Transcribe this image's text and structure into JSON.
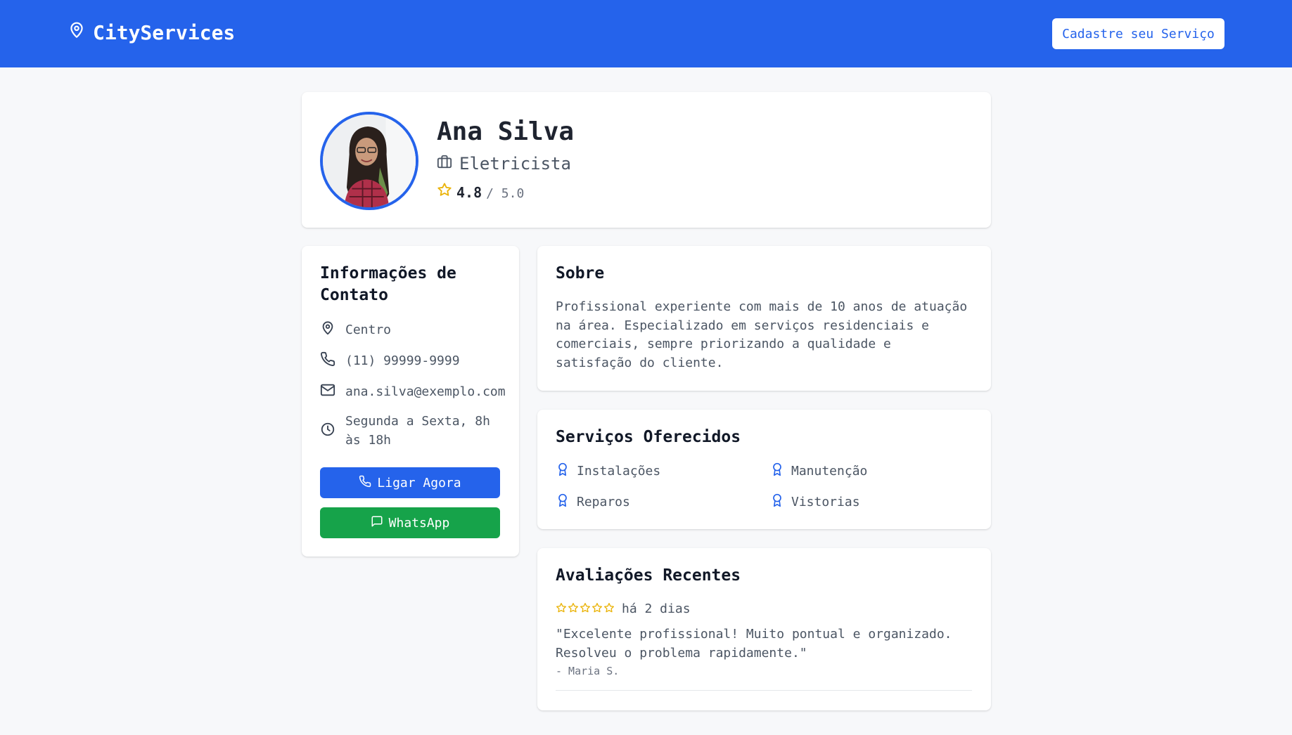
{
  "header": {
    "brand": "CityServices",
    "cta_label": "Cadastre seu Serviço",
    "brand_color": "#2563eb"
  },
  "profile": {
    "name": "Ana Silva",
    "profession": "Eletricista",
    "rating": "4.8",
    "rating_max": "/ 5.0"
  },
  "contact": {
    "title": "Informações de Contato",
    "location": "Centro",
    "phone": "(11) 99999-9999",
    "email": "ana.silva@exemplo.com",
    "hours": "Segunda a Sexta, 8h às 18h",
    "call_label": "Ligar Agora",
    "whatsapp_label": "WhatsApp",
    "whatsapp_color": "#16a34a"
  },
  "about": {
    "title": "Sobre",
    "text": "Profissional experiente com mais de 10 anos de atuação na área. Especializado em serviços residenciais e comerciais, sempre priorizando a qualidade e satisfação do cliente."
  },
  "services": {
    "title": "Serviços Oferecidos",
    "items": [
      "Instalações",
      "Manutenção",
      "Reparos",
      "Vistorias"
    ]
  },
  "reviews": {
    "title": "Avaliações Recentes",
    "items": [
      {
        "stars": 5,
        "date": "há 2 dias",
        "text": "\"Excelente profissional! Muito pontual e organizado. Resolveu o problema rapidamente.\"",
        "author": "- Maria S."
      }
    ]
  }
}
